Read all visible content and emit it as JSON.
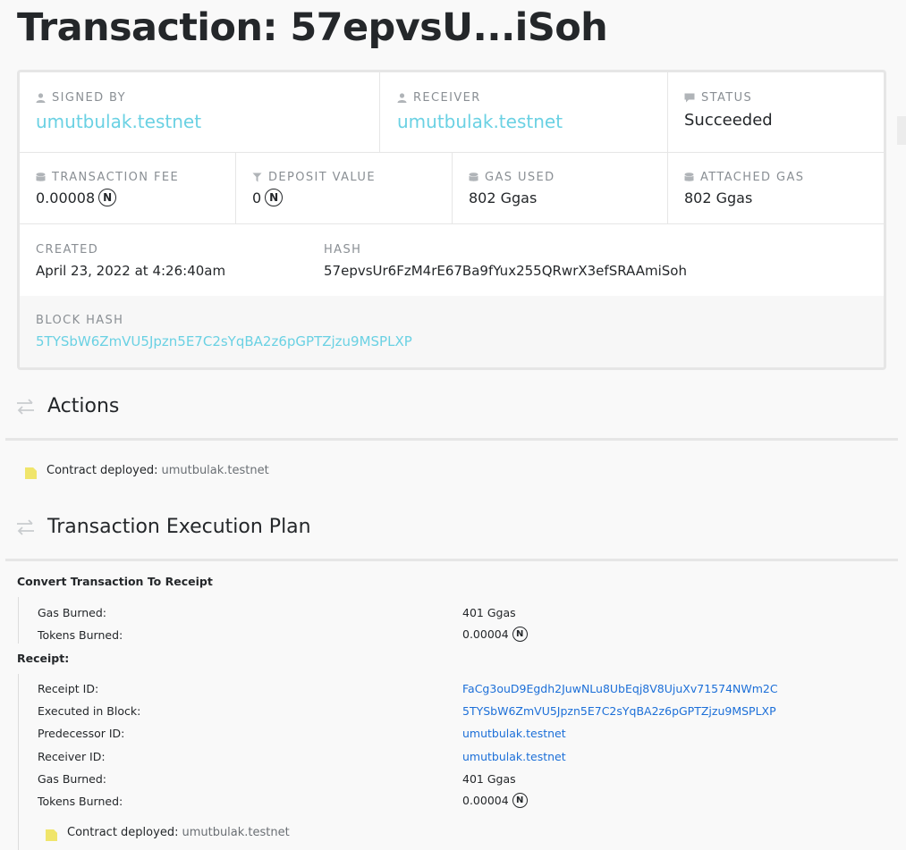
{
  "title": "Transaction: 57epvsU...iSoh",
  "summary": {
    "signed_by_label": "SIGNED BY",
    "signed_by": "umutbulak.testnet",
    "receiver_label": "RECEIVER",
    "receiver": "umutbulak.testnet",
    "status_label": "STATUS",
    "status": "Succeeded",
    "fee_label": "TRANSACTION FEE",
    "fee": "0.00008",
    "deposit_label": "DEPOSIT VALUE",
    "deposit": "0",
    "gas_used_label": "GAS USED",
    "gas_used": "802 Ggas",
    "attached_gas_label": "ATTACHED GAS",
    "attached_gas": "802 Ggas",
    "created_label": "CREATED",
    "created": "April 23, 2022 at 4:26:40am",
    "hash_label": "HASH",
    "hash": "57epvsUr6FzM4rE67Ba9fYux255QRwrX3efSRAAmiSoh",
    "block_hash_label": "BLOCK HASH",
    "block_hash": "5TYSbW6ZmVU5Jpzn5E7C2sYqBA2z6pGPTZjzu9MSPLXP",
    "near_symbol": "N"
  },
  "actions": {
    "heading": "Actions",
    "item_text": "Contract deployed:",
    "item_account": "umutbulak.testnet"
  },
  "plan": {
    "heading": "Transaction Execution Plan",
    "convert_title": "Convert Transaction To Receipt",
    "convert_rows": [
      {
        "key": "Gas Burned:",
        "value": "401 Ggas"
      },
      {
        "key": "Tokens Burned:",
        "value": "0.00004"
      }
    ],
    "receipt_title": "Receipt:",
    "receipt_rows": [
      {
        "key": "Receipt ID:",
        "value": "FaCg3ouD9Egdh2JuwNLu8UbEqj8V8UjuXv71574NWm2C"
      },
      {
        "key": "Executed in Block:",
        "value": "5TYSbW6ZmVU5Jpzn5E7C2sYqBA2z6pGPTZjzu9MSPLXP"
      },
      {
        "key": "Predecessor ID:",
        "value": "umutbulak.testnet"
      },
      {
        "key": "Receiver ID:",
        "value": "umutbulak.testnet"
      },
      {
        "key": "Gas Burned:",
        "value": "401 Ggas"
      },
      {
        "key": "Tokens Burned:",
        "value": "0.00004"
      }
    ],
    "receipt_action_text": "Contract deployed:",
    "receipt_action_account": "umutbulak.testnet"
  },
  "colors": {
    "link": "#6ad1e3",
    "plan_link": "#1c6fd8",
    "action_icon": "#f0e56b"
  }
}
